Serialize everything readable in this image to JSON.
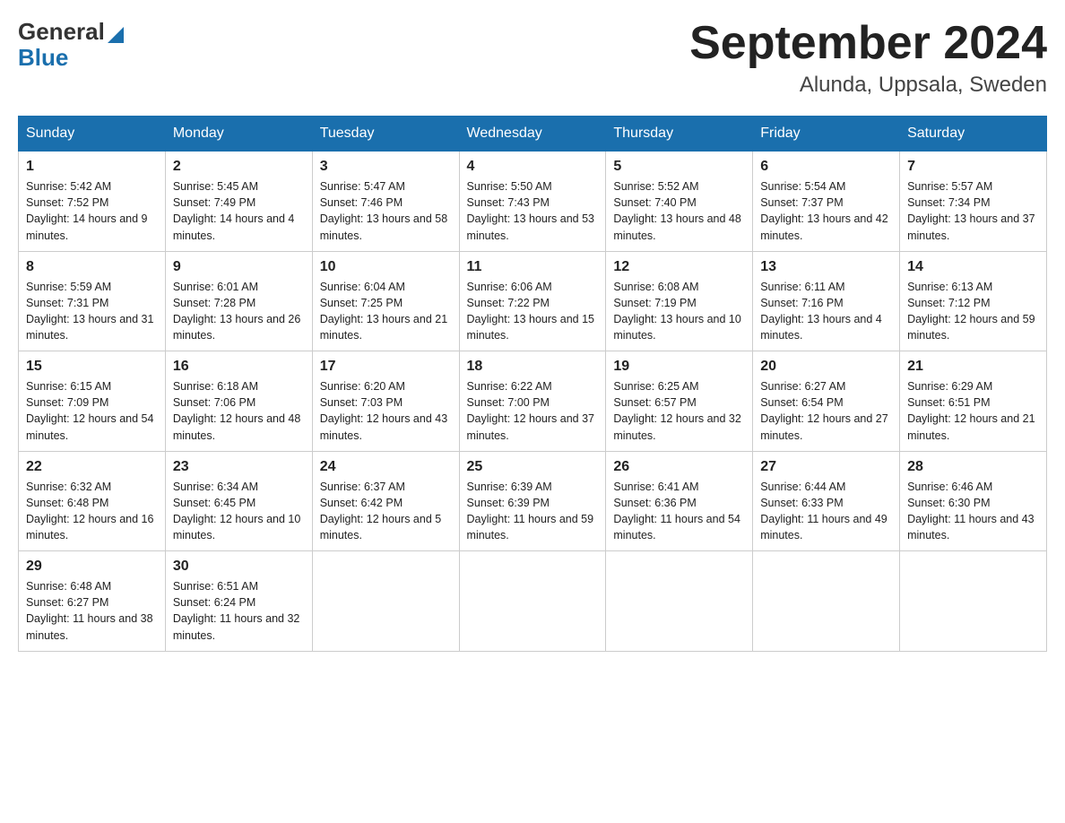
{
  "header": {
    "logo_general": "General",
    "logo_blue": "Blue",
    "month_title": "September 2024",
    "location": "Alunda, Uppsala, Sweden"
  },
  "calendar": {
    "days_of_week": [
      "Sunday",
      "Monday",
      "Tuesday",
      "Wednesday",
      "Thursday",
      "Friday",
      "Saturday"
    ],
    "weeks": [
      [
        {
          "day": "1",
          "sunrise": "5:42 AM",
          "sunset": "7:52 PM",
          "daylight": "14 hours and 9 minutes."
        },
        {
          "day": "2",
          "sunrise": "5:45 AM",
          "sunset": "7:49 PM",
          "daylight": "14 hours and 4 minutes."
        },
        {
          "day": "3",
          "sunrise": "5:47 AM",
          "sunset": "7:46 PM",
          "daylight": "13 hours and 58 minutes."
        },
        {
          "day": "4",
          "sunrise": "5:50 AM",
          "sunset": "7:43 PM",
          "daylight": "13 hours and 53 minutes."
        },
        {
          "day": "5",
          "sunrise": "5:52 AM",
          "sunset": "7:40 PM",
          "daylight": "13 hours and 48 minutes."
        },
        {
          "day": "6",
          "sunrise": "5:54 AM",
          "sunset": "7:37 PM",
          "daylight": "13 hours and 42 minutes."
        },
        {
          "day": "7",
          "sunrise": "5:57 AM",
          "sunset": "7:34 PM",
          "daylight": "13 hours and 37 minutes."
        }
      ],
      [
        {
          "day": "8",
          "sunrise": "5:59 AM",
          "sunset": "7:31 PM",
          "daylight": "13 hours and 31 minutes."
        },
        {
          "day": "9",
          "sunrise": "6:01 AM",
          "sunset": "7:28 PM",
          "daylight": "13 hours and 26 minutes."
        },
        {
          "day": "10",
          "sunrise": "6:04 AM",
          "sunset": "7:25 PM",
          "daylight": "13 hours and 21 minutes."
        },
        {
          "day": "11",
          "sunrise": "6:06 AM",
          "sunset": "7:22 PM",
          "daylight": "13 hours and 15 minutes."
        },
        {
          "day": "12",
          "sunrise": "6:08 AM",
          "sunset": "7:19 PM",
          "daylight": "13 hours and 10 minutes."
        },
        {
          "day": "13",
          "sunrise": "6:11 AM",
          "sunset": "7:16 PM",
          "daylight": "13 hours and 4 minutes."
        },
        {
          "day": "14",
          "sunrise": "6:13 AM",
          "sunset": "7:12 PM",
          "daylight": "12 hours and 59 minutes."
        }
      ],
      [
        {
          "day": "15",
          "sunrise": "6:15 AM",
          "sunset": "7:09 PM",
          "daylight": "12 hours and 54 minutes."
        },
        {
          "day": "16",
          "sunrise": "6:18 AM",
          "sunset": "7:06 PM",
          "daylight": "12 hours and 48 minutes."
        },
        {
          "day": "17",
          "sunrise": "6:20 AM",
          "sunset": "7:03 PM",
          "daylight": "12 hours and 43 minutes."
        },
        {
          "day": "18",
          "sunrise": "6:22 AM",
          "sunset": "7:00 PM",
          "daylight": "12 hours and 37 minutes."
        },
        {
          "day": "19",
          "sunrise": "6:25 AM",
          "sunset": "6:57 PM",
          "daylight": "12 hours and 32 minutes."
        },
        {
          "day": "20",
          "sunrise": "6:27 AM",
          "sunset": "6:54 PM",
          "daylight": "12 hours and 27 minutes."
        },
        {
          "day": "21",
          "sunrise": "6:29 AM",
          "sunset": "6:51 PM",
          "daylight": "12 hours and 21 minutes."
        }
      ],
      [
        {
          "day": "22",
          "sunrise": "6:32 AM",
          "sunset": "6:48 PM",
          "daylight": "12 hours and 16 minutes."
        },
        {
          "day": "23",
          "sunrise": "6:34 AM",
          "sunset": "6:45 PM",
          "daylight": "12 hours and 10 minutes."
        },
        {
          "day": "24",
          "sunrise": "6:37 AM",
          "sunset": "6:42 PM",
          "daylight": "12 hours and 5 minutes."
        },
        {
          "day": "25",
          "sunrise": "6:39 AM",
          "sunset": "6:39 PM",
          "daylight": "11 hours and 59 minutes."
        },
        {
          "day": "26",
          "sunrise": "6:41 AM",
          "sunset": "6:36 PM",
          "daylight": "11 hours and 54 minutes."
        },
        {
          "day": "27",
          "sunrise": "6:44 AM",
          "sunset": "6:33 PM",
          "daylight": "11 hours and 49 minutes."
        },
        {
          "day": "28",
          "sunrise": "6:46 AM",
          "sunset": "6:30 PM",
          "daylight": "11 hours and 43 minutes."
        }
      ],
      [
        {
          "day": "29",
          "sunrise": "6:48 AM",
          "sunset": "6:27 PM",
          "daylight": "11 hours and 38 minutes."
        },
        {
          "day": "30",
          "sunrise": "6:51 AM",
          "sunset": "6:24 PM",
          "daylight": "11 hours and 32 minutes."
        },
        null,
        null,
        null,
        null,
        null
      ]
    ]
  }
}
